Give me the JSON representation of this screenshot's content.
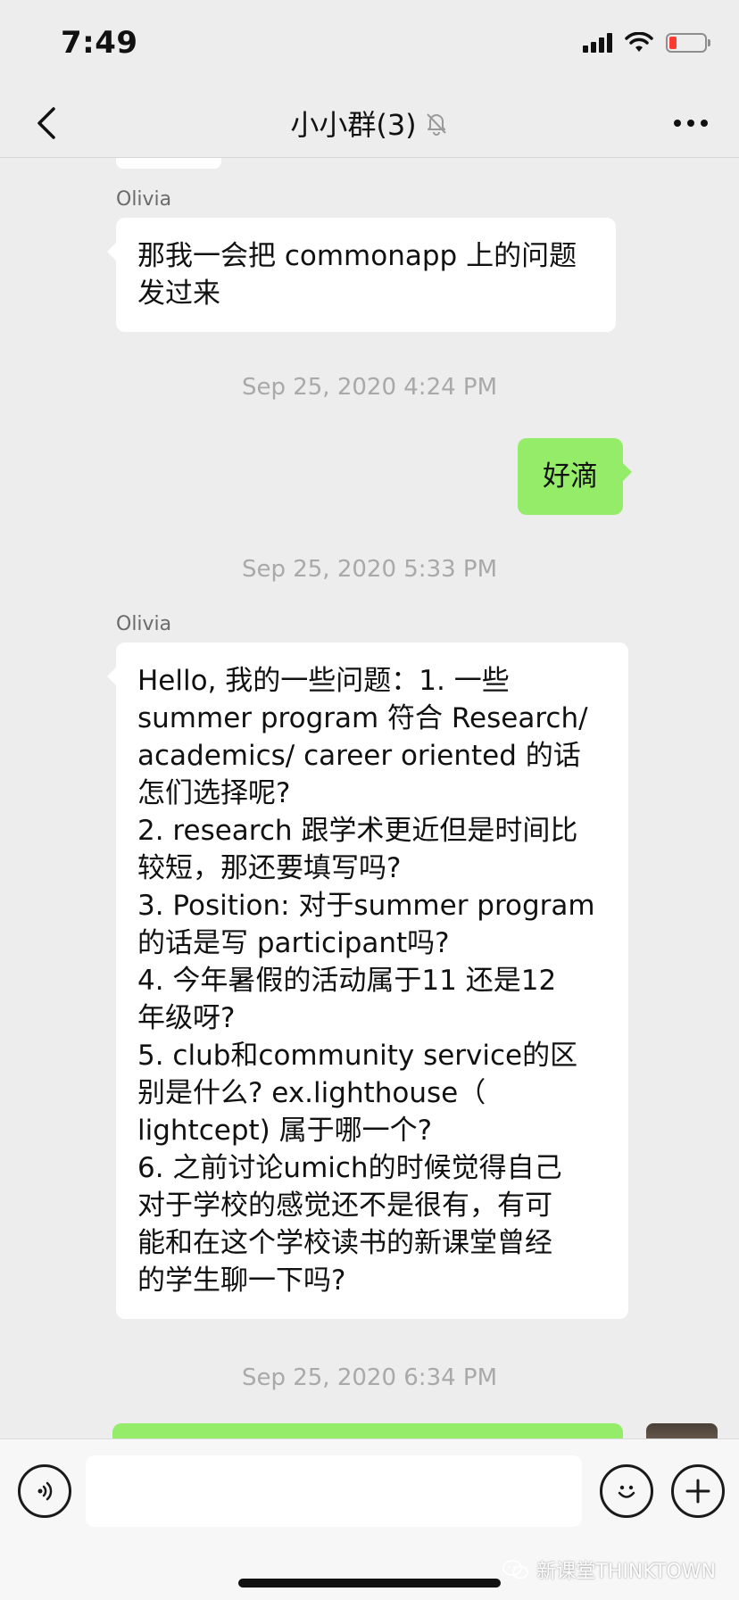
{
  "status_bar": {
    "time": "7:49",
    "icons": [
      "signal-icon",
      "wifi-icon",
      "battery-low-icon"
    ],
    "battery_color": "#ff3b30"
  },
  "nav": {
    "title": "小小群(3)",
    "back_icon": "chevron-left-icon",
    "mute_icon": "bell-slash-icon",
    "more_icon": "ellipsis-icon"
  },
  "messages": [
    {
      "sender": "Olivia",
      "side": "left",
      "text": "那我一会把 commonapp 上的问题\n发过来"
    },
    {
      "type": "timestamp",
      "text": "Sep 25, 2020 4:24 PM"
    },
    {
      "side": "right",
      "text": "好滴"
    },
    {
      "type": "timestamp",
      "text": "Sep 25, 2020 5:33 PM"
    },
    {
      "sender": "Olivia",
      "side": "left",
      "text": "Hello, 我的一些问题：1. 一些\nsummer program 符合 Research/\nacademics/ career oriented 的话\n怎们选择呢?\n2. research 跟学术更近但是时间比\n较短，那还要填写吗?\n3. Position: 对于summer program\n的话是写 participant吗?\n4. 今年暑假的活动属于11 还是12\n年级呀?\n5. club和community service的区\n别是什么? ex.lighthouse（\nlightcept) 属于哪一个?\n6. 之前讨论umich的时候觉得自己\n对于学校的感觉还不是很有，有可\n能和在这个学校读书的新课堂曾经\n的学生聊一下吗?"
    },
    {
      "type": "timestamp",
      "text": "Sep 25, 2020 6:34 PM"
    }
  ],
  "input_bar": {
    "placeholder": "",
    "voice_icon": "voice-icon",
    "emoji_icon": "emoji-icon",
    "plus_icon": "plus-icon"
  },
  "watermark": {
    "text": "新课堂THINKTOWN",
    "icon": "wechat-icon"
  },
  "colors": {
    "background": "#ededed",
    "sent_bubble": "#95ec69",
    "received_bubble": "#ffffff",
    "timestamp": "#a9a9a9"
  }
}
